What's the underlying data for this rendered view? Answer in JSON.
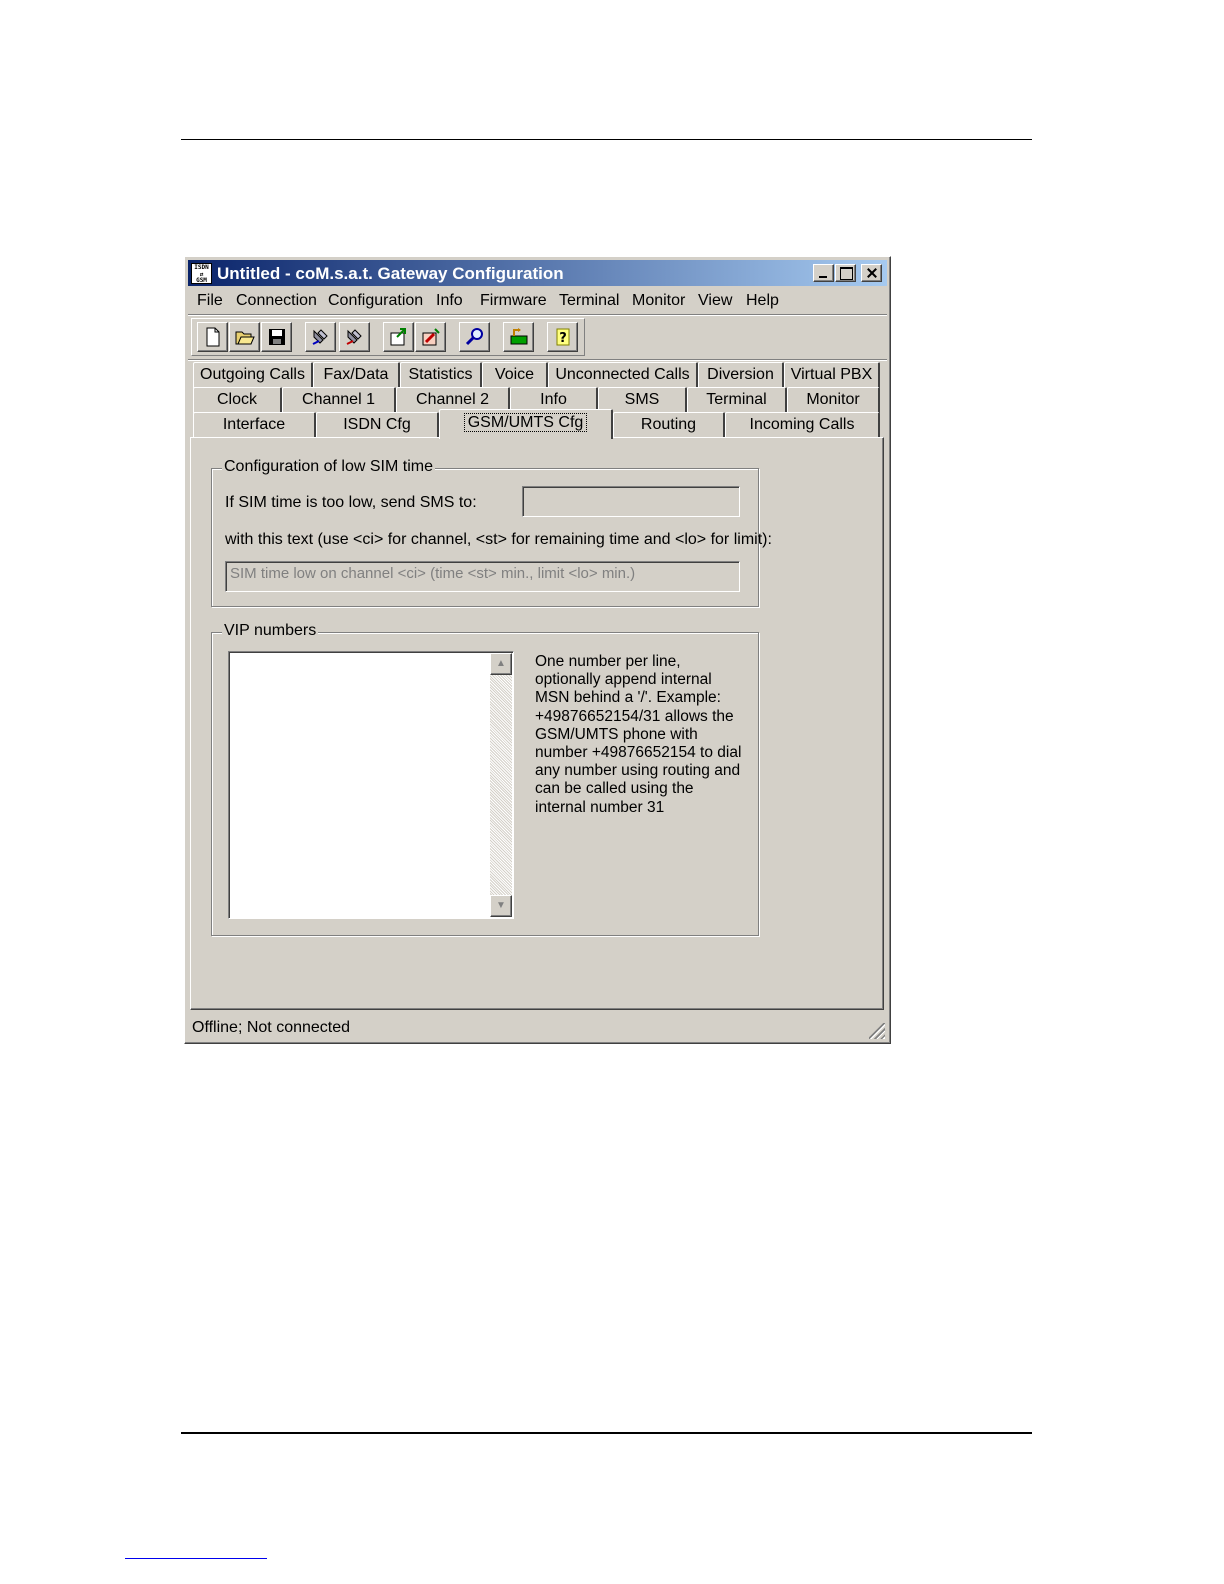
{
  "window": {
    "icon_text": [
      "ISDN",
      "⇄",
      "GSM"
    ],
    "title": "Untitled - coM.s.a.t. Gateway Configuration"
  },
  "menu": [
    "File",
    "Connection",
    "Configuration",
    "Info",
    "Firmware",
    "Terminal",
    "Monitor",
    "View",
    "Help"
  ],
  "toolbar": {
    "icons": [
      "new-file-icon",
      "open-folder-icon",
      "save-disk-icon",
      "read-device-icon",
      "write-device-icon",
      "upload-icon",
      "download-icon",
      "search-icon",
      "network-icon",
      "help-icon"
    ],
    "help_glyph": "?"
  },
  "tabs": {
    "row1": [
      "Outgoing Calls",
      "Fax/Data",
      "Statistics",
      "Voice",
      "Unconnected Calls",
      "Diversion",
      "Virtual PBX"
    ],
    "row2": [
      "Clock",
      "Channel 1",
      "Channel 2",
      "Info",
      "SMS",
      "Terminal",
      "Monitor"
    ],
    "row3": [
      "Interface",
      "ISDN Cfg",
      "GSM/UMTS Cfg",
      "Routing",
      "Incoming Calls"
    ],
    "active": "GSM/UMTS Cfg"
  },
  "sim_group": {
    "title": "Configuration of low SIM time",
    "sms_label": "If SIM time is too low, send SMS to:",
    "sms_value": "",
    "text_label": "with this text (use <ci> for channel, <st> for remaining time and <lo> for limit):",
    "text_value": "SIM time low on channel <ci> (time <st> min., limit <lo> min.)"
  },
  "vip_group": {
    "title": "VIP numbers",
    "list_items": [],
    "help_lines": [
      "One number per line,",
      "optionally append internal",
      "MSN behind a '/'. Example:",
      "+49876652154/31 allows the",
      "GSM/UMTS phone with",
      "number +49876652154 to dial",
      "any number using routing and",
      "can be called using the",
      "internal number 31"
    ]
  },
  "status": {
    "text": "Offline; Not connected"
  }
}
